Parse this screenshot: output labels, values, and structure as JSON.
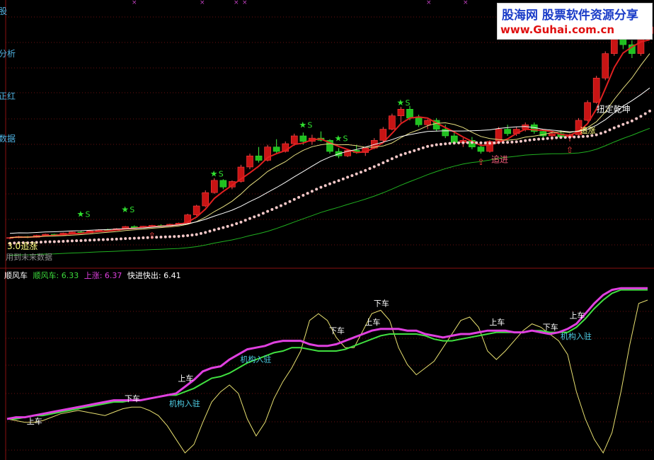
{
  "watermark": {
    "line1": "股海网 股票软件资源分享",
    "line2": "www.Guhai.com.cn",
    "brand_color": "#1a3cc8",
    "accent_color": "#e01010"
  },
  "upper_annotations": {
    "zhuizhang_30": "3.0追涨",
    "future_data": "用到未来数据",
    "zhuijin": "追进",
    "zhuizhang": "追涨",
    "niuzhuan": "扭定乾坤",
    "star_label": "S"
  },
  "indicator": {
    "name": "顺风车",
    "legend": [
      {
        "label": "顺风车: 6.33",
        "color": "#3cdc3c"
      },
      {
        "label": "上涨: 6.37",
        "color": "#e040e0"
      },
      {
        "label": "快进快出: 6.41",
        "color": "#ffffff"
      }
    ]
  },
  "lower_annotations": [
    {
      "text": "上车",
      "color": "#ffffff"
    },
    {
      "text": "下车",
      "color": "#ffffff"
    },
    {
      "text": "上车",
      "color": "#ffffff"
    },
    {
      "text": "机构入驻",
      "color": "#4fd0e8"
    },
    {
      "text": "机构入驻",
      "color": "#4fd0e8"
    },
    {
      "text": "下车",
      "color": "#ffffff"
    },
    {
      "text": "上车",
      "color": "#ffffff"
    },
    {
      "text": "下车",
      "color": "#ffffff"
    },
    {
      "text": "上车",
      "color": "#ffffff"
    },
    {
      "text": "下车",
      "color": "#ffffff"
    },
    {
      "text": "上车",
      "color": "#ffffff"
    },
    {
      "text": "机构入驻",
      "color": "#4fd0e8"
    }
  ],
  "left_axis_fragments": [
    "股",
    "分析",
    "正红",
    "数据"
  ],
  "colors": {
    "up_candle": "#c81414",
    "down_candle": "#20c020",
    "ma_red": "#e02020",
    "ma_green": "#40e040",
    "ma_yellow": "#e8e080",
    "ma_white": "#ffffff",
    "dot_line": "#f4c8c8",
    "support_green": "#20b020",
    "grid": "#6a1010",
    "magenta": "#e040e0",
    "lime": "#40e040",
    "yellow_line": "#e8e070"
  },
  "chart_data": [
    {
      "type": "candlestick",
      "title": "",
      "series": [
        {
          "name": "candles",
          "values": [
            [
              10.2,
              10.3,
              10.1,
              10.25
            ],
            [
              10.25,
              10.4,
              10.2,
              10.35
            ],
            [
              10.35,
              10.4,
              10.2,
              10.28
            ],
            [
              10.28,
              10.5,
              10.25,
              10.45
            ],
            [
              10.45,
              10.6,
              10.4,
              10.55
            ],
            [
              10.55,
              10.6,
              10.4,
              10.48
            ],
            [
              10.48,
              10.7,
              10.45,
              10.65
            ],
            [
              10.65,
              10.8,
              10.6,
              10.75
            ],
            [
              10.75,
              10.85,
              10.6,
              10.68
            ],
            [
              10.68,
              10.9,
              10.65,
              10.85
            ],
            [
              10.85,
              11.0,
              10.8,
              10.95
            ],
            [
              10.95,
              11.05,
              10.85,
              10.9
            ],
            [
              10.9,
              11.1,
              10.88,
              11.05
            ],
            [
              11.05,
              11.3,
              11.0,
              11.25
            ],
            [
              11.25,
              11.35,
              11.1,
              11.15
            ],
            [
              11.15,
              11.3,
              11.1,
              11.28
            ],
            [
              11.28,
              11.4,
              11.2,
              11.35
            ],
            [
              11.35,
              11.45,
              11.25,
              11.3
            ],
            [
              11.3,
              11.5,
              11.28,
              11.45
            ],
            [
              11.45,
              11.6,
              11.4,
              11.55
            ],
            [
              11.55,
              12.4,
              11.5,
              12.3
            ],
            [
              12.3,
              13.2,
              12.2,
              13.1
            ],
            [
              13.1,
              14.5,
              13.0,
              14.3
            ],
            [
              14.3,
              15.6,
              14.2,
              15.4
            ],
            [
              15.4,
              15.5,
              14.6,
              14.8
            ],
            [
              14.8,
              15.4,
              14.6,
              15.3
            ],
            [
              15.3,
              16.8,
              15.2,
              16.6
            ],
            [
              16.6,
              17.8,
              16.4,
              17.6
            ],
            [
              17.6,
              18.4,
              17.0,
              17.2
            ],
            [
              17.2,
              18.6,
              17.1,
              18.4
            ],
            [
              18.4,
              19.1,
              17.8,
              18.0
            ],
            [
              18.0,
              18.9,
              17.9,
              18.7
            ],
            [
              18.7,
              19.6,
              18.5,
              19.4
            ],
            [
              19.4,
              19.7,
              18.6,
              18.9
            ],
            [
              18.9,
              19.5,
              18.6,
              19.2
            ],
            [
              19.2,
              19.8,
              18.9,
              19.0
            ],
            [
              19.0,
              19.1,
              17.8,
              18.0
            ],
            [
              18.0,
              18.3,
              17.4,
              17.6
            ],
            [
              17.6,
              18.2,
              17.5,
              18.1
            ],
            [
              18.1,
              18.6,
              17.8,
              17.9
            ],
            [
              17.9,
              18.4,
              17.6,
              18.3
            ],
            [
              18.3,
              19.2,
              18.2,
              19.0
            ],
            [
              19.0,
              20.2,
              18.9,
              20.0
            ],
            [
              20.0,
              21.4,
              19.9,
              21.2
            ],
            [
              21.2,
              22.0,
              20.6,
              21.8
            ],
            [
              21.8,
              22.1,
              20.8,
              21.0
            ],
            [
              21.0,
              21.3,
              20.2,
              20.4
            ],
            [
              20.4,
              20.9,
              20.0,
              20.8
            ],
            [
              20.8,
              21.0,
              19.8,
              20.0
            ],
            [
              20.0,
              20.4,
              19.2,
              19.4
            ],
            [
              19.4,
              19.8,
              18.6,
              18.8
            ],
            [
              18.8,
              19.2,
              18.4,
              19.0
            ],
            [
              19.0,
              19.3,
              18.2,
              18.4
            ],
            [
              18.4,
              18.6,
              17.8,
              18.0
            ],
            [
              18.0,
              19.0,
              17.9,
              18.9
            ],
            [
              18.9,
              20.2,
              18.8,
              20.0
            ],
            [
              20.0,
              20.4,
              19.4,
              19.6
            ],
            [
              19.6,
              20.2,
              19.4,
              20.0
            ],
            [
              20.0,
              20.6,
              19.8,
              20.4
            ],
            [
              20.4,
              20.6,
              19.6,
              19.8
            ],
            [
              19.8,
              20.0,
              19.2,
              19.4
            ],
            [
              19.4,
              19.8,
              19.0,
              19.6
            ],
            [
              19.6,
              19.9,
              19.2,
              19.3
            ],
            [
              19.3,
              19.6,
              18.9,
              19.5
            ],
            [
              19.5,
              21.0,
              19.4,
              20.8
            ],
            [
              20.8,
              22.6,
              20.7,
              22.4
            ],
            [
              22.4,
              24.8,
              22.3,
              24.6
            ],
            [
              24.6,
              27.0,
              24.4,
              26.8
            ],
            [
              26.8,
              28.6,
              26.6,
              28.4
            ],
            [
              28.4,
              29.0,
              27.2,
              27.6
            ],
            [
              27.6,
              28.0,
              26.4,
              26.8
            ],
            [
              26.8,
              28.8,
              26.6,
              28.6
            ],
            [
              28.6,
              29.6,
              28.2,
              29.2
            ]
          ]
        }
      ]
    },
    {
      "type": "line",
      "title": "顺风车",
      "series": [
        {
          "name": "顺风车",
          "color": "#40e040",
          "values": [
            0.2,
            0.2,
            0.21,
            0.22,
            0.22,
            0.23,
            0.24,
            0.25,
            0.26,
            0.27,
            0.28,
            0.29,
            0.3,
            0.3,
            0.31,
            0.31,
            0.32,
            0.33,
            0.34,
            0.34,
            0.36,
            0.38,
            0.41,
            0.44,
            0.45,
            0.47,
            0.5,
            0.53,
            0.55,
            0.57,
            0.59,
            0.6,
            0.62,
            0.62,
            0.61,
            0.6,
            0.6,
            0.6,
            0.61,
            0.63,
            0.65,
            0.67,
            0.69,
            0.7,
            0.7,
            0.7,
            0.7,
            0.69,
            0.67,
            0.66,
            0.66,
            0.67,
            0.68,
            0.69,
            0.7,
            0.71,
            0.71,
            0.71,
            0.71,
            0.72,
            0.72,
            0.71,
            0.71,
            0.71,
            0.74,
            0.79,
            0.85,
            0.9,
            0.94,
            0.96,
            0.96,
            0.96,
            0.96
          ]
        },
        {
          "name": "上涨",
          "color": "#e040e0",
          "values": [
            0.2,
            0.21,
            0.21,
            0.22,
            0.23,
            0.24,
            0.25,
            0.26,
            0.27,
            0.28,
            0.29,
            0.3,
            0.31,
            0.31,
            0.31,
            0.31,
            0.32,
            0.33,
            0.34,
            0.35,
            0.39,
            0.43,
            0.48,
            0.5,
            0.51,
            0.55,
            0.58,
            0.61,
            0.62,
            0.63,
            0.65,
            0.66,
            0.66,
            0.66,
            0.64,
            0.63,
            0.63,
            0.64,
            0.66,
            0.68,
            0.7,
            0.72,
            0.73,
            0.73,
            0.73,
            0.72,
            0.72,
            0.7,
            0.69,
            0.68,
            0.69,
            0.7,
            0.7,
            0.71,
            0.72,
            0.72,
            0.72,
            0.71,
            0.71,
            0.72,
            0.71,
            0.7,
            0.71,
            0.73,
            0.76,
            0.82,
            0.88,
            0.93,
            0.96,
            0.97,
            0.97,
            0.97,
            0.97
          ]
        },
        {
          "name": "快进快出",
          "color": "#e8e070",
          "values": [
            0.2,
            0.19,
            0.18,
            0.18,
            0.19,
            0.21,
            0.23,
            0.24,
            0.25,
            0.24,
            0.23,
            0.22,
            0.24,
            0.26,
            0.27,
            0.27,
            0.25,
            0.22,
            0.16,
            0.08,
            0.0,
            0.05,
            0.18,
            0.3,
            0.36,
            0.4,
            0.35,
            0.2,
            0.1,
            0.18,
            0.32,
            0.42,
            0.5,
            0.6,
            0.78,
            0.82,
            0.78,
            0.68,
            0.62,
            0.62,
            0.72,
            0.82,
            0.84,
            0.78,
            0.62,
            0.52,
            0.46,
            0.5,
            0.54,
            0.62,
            0.7,
            0.78,
            0.8,
            0.74,
            0.6,
            0.55,
            0.6,
            0.66,
            0.72,
            0.76,
            0.74,
            0.7,
            0.66,
            0.58,
            0.36,
            0.2,
            0.08,
            0.0,
            0.12,
            0.36,
            0.64,
            0.88,
            0.9
          ]
        }
      ]
    }
  ]
}
